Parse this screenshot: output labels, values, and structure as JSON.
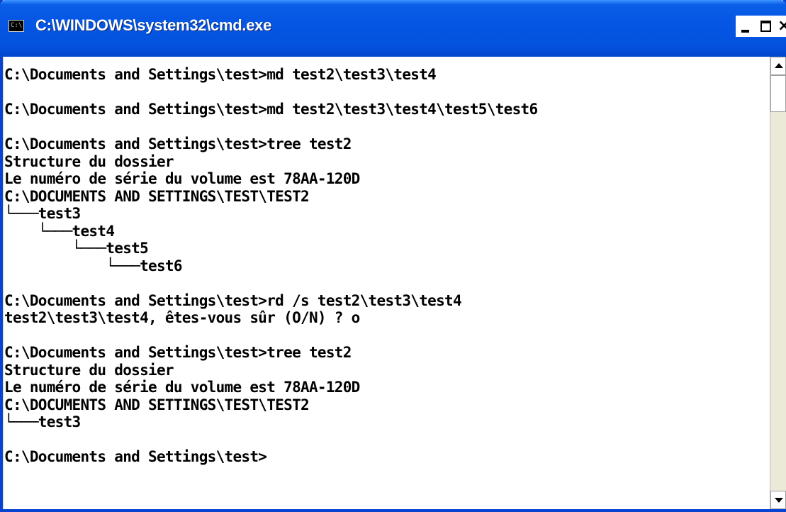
{
  "window": {
    "title": "C:\\WINDOWS\\system32\\cmd.exe",
    "icon_text": "C:\\"
  },
  "caption_buttons": {
    "minimize_icon": "minimize-icon",
    "maximize_icon": "maximize-icon",
    "close_glyph": "×"
  },
  "console": {
    "background": "#ffffff",
    "foreground": "#000000",
    "lines": [
      "C:\\Documents and Settings\\test>md test2\\test3\\test4",
      "",
      "C:\\Documents and Settings\\test>md test2\\test3\\test4\\test5\\test6",
      "",
      "C:\\Documents and Settings\\test>tree test2",
      "Structure du dossier",
      "Le numéro de série du volume est 78AA-120D",
      "C:\\DOCUMENTS AND SETTINGS\\TEST\\TEST2",
      "└───test3",
      "    └───test4",
      "        └───test5",
      "            └───test6",
      "",
      "C:\\Documents and Settings\\test>rd /s test2\\test3\\test4",
      "test2\\test3\\test4, êtes-vous sûr (O/N) ? o",
      "",
      "C:\\Documents and Settings\\test>tree test2",
      "Structure du dossier",
      "Le numéro de série du volume est 78AA-120D",
      "C:\\DOCUMENTS AND SETTINGS\\TEST\\TEST2",
      "└───test3",
      "",
      "C:\\Documents and Settings\\test>"
    ]
  },
  "colors": {
    "titlebar": "#0556e3",
    "frame": "#0843d1"
  }
}
